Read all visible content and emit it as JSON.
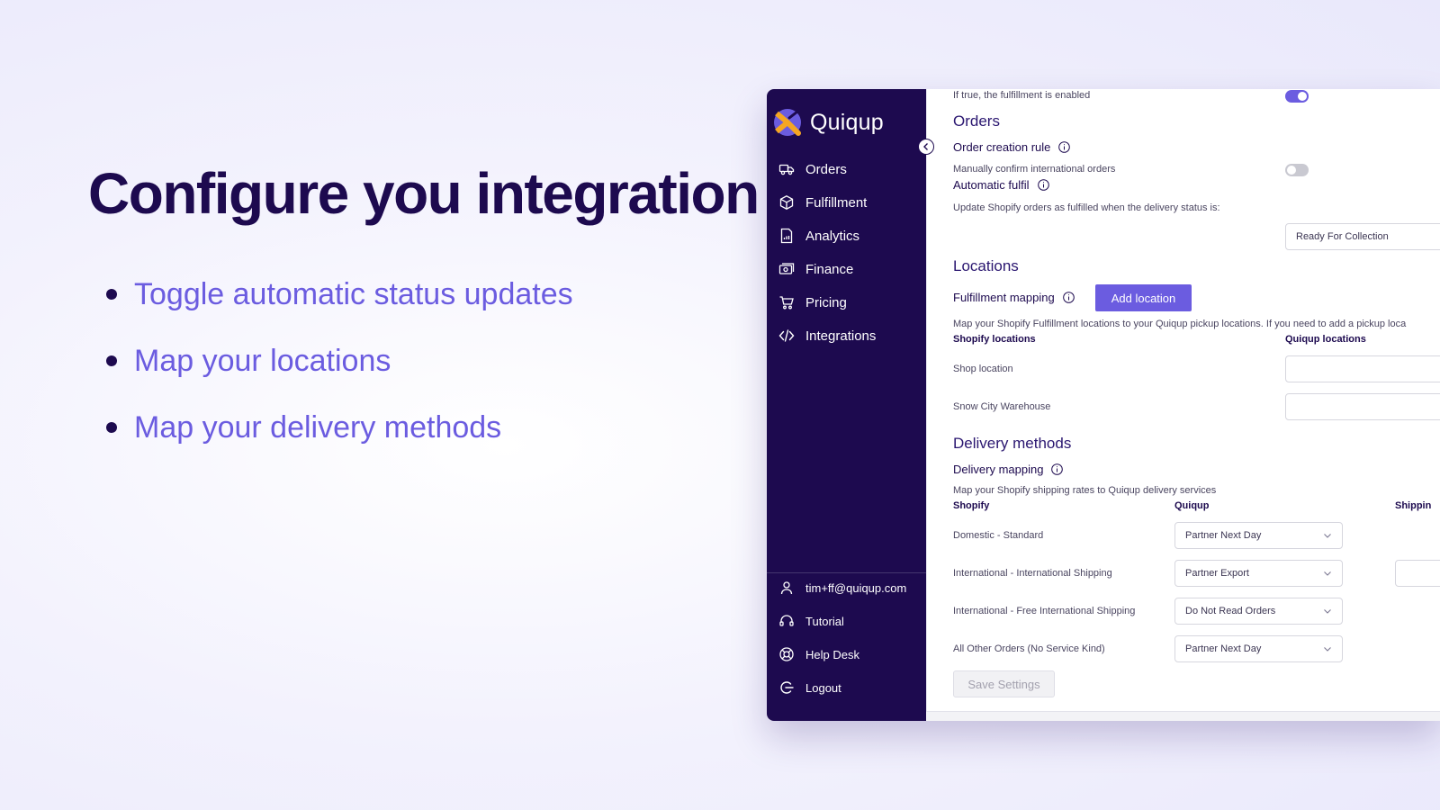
{
  "hero": {
    "headline": "Configure you integration",
    "bullets": [
      "Toggle automatic status updates",
      "Map your locations",
      "Map your delivery methods"
    ]
  },
  "app": {
    "brand": "Quiqup",
    "sidebar": {
      "nav": [
        {
          "label": "Orders",
          "icon": "truck-icon"
        },
        {
          "label": "Fulfillment",
          "icon": "box-icon"
        },
        {
          "label": "Analytics",
          "icon": "report-icon"
        },
        {
          "label": "Finance",
          "icon": "cash-icon"
        },
        {
          "label": "Pricing",
          "icon": "cart-icon"
        },
        {
          "label": "Integrations",
          "icon": "code-icon"
        }
      ],
      "footer": [
        {
          "label": "tim+ff@quiqup.com",
          "icon": "user-icon"
        },
        {
          "label": "Tutorial",
          "icon": "headset-icon"
        },
        {
          "label": "Help Desk",
          "icon": "lifebuoy-icon"
        },
        {
          "label": "Logout",
          "icon": "logout-icon"
        }
      ]
    },
    "content": {
      "fulfillment_enabled_text": "If true, the fulfillment is enabled",
      "fulfillment_enabled": true,
      "orders": {
        "title": "Orders",
        "creation_rule_label": "Order creation rule",
        "manual_confirm_text": "Manually confirm international orders",
        "manual_confirm": false,
        "auto_fulfil_label": "Automatic fulfil",
        "auto_fulfil_desc": "Update Shopify orders as fulfilled when the delivery status is:",
        "auto_fulfil_status": "Ready For Collection"
      },
      "locations": {
        "title": "Locations",
        "mapping_label": "Fulfillment mapping",
        "add_button": "Add location",
        "desc": "Map your Shopify Fulfillment locations to your Quiqup pickup locations. If you need to add a pickup loca",
        "col_shopify": "Shopify locations",
        "col_quiqup": "Quiqup locations",
        "rows": [
          {
            "shopify": "Shop location",
            "quiqup": ""
          },
          {
            "shopify": "Snow City Warehouse",
            "quiqup": ""
          }
        ]
      },
      "delivery": {
        "title": "Delivery methods",
        "mapping_label": "Delivery mapping",
        "desc": "Map your Shopify shipping rates to Quiqup delivery services",
        "col_shopify": "Shopify",
        "col_quiqup": "Quiqup",
        "col_shipping": "Shippin",
        "rows": [
          {
            "shopify": "Domestic - Standard",
            "quiqup": "Partner Next Day"
          },
          {
            "shopify": "International - International Shipping",
            "quiqup": "Partner Export"
          },
          {
            "shopify": "International - Free International Shipping",
            "quiqup": "Do Not Read Orders"
          },
          {
            "shopify": "All Other Orders (No Service Kind)",
            "quiqup": "Partner Next Day"
          }
        ]
      },
      "save_button": "Save Settings"
    }
  },
  "colors": {
    "navy": "#1d0a4f",
    "accent": "#6b5ce0",
    "bullet_text": "#6b5ce0",
    "logo_orange": "#f5a623"
  }
}
